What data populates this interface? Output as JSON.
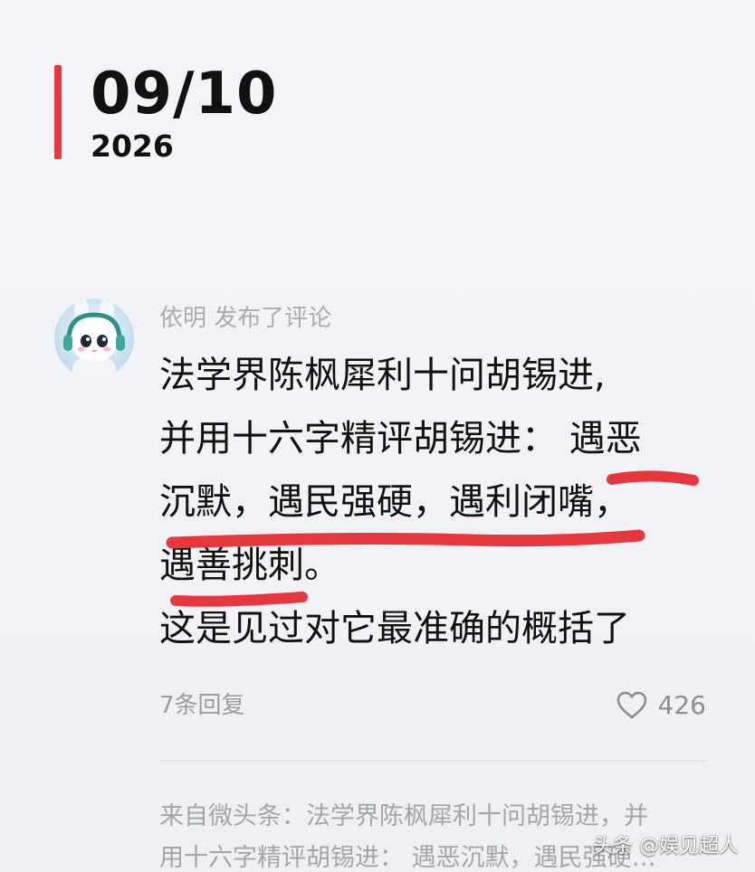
{
  "date": {
    "day_month": "09/10",
    "year": "2026",
    "accent_color": "#e8383d"
  },
  "comment": {
    "author_line": "依明 发布了评论",
    "avatar_icon": "cartoon-bunny-with-headphones",
    "lines": [
      "法学界陈枫犀利十问胡锡进,",
      "并用十六字精评胡锡进： 遇恶",
      "沉默，遇民强硬，遇利闭嘴，",
      "遇善挑刺。",
      "这是见过对它最准确的概括了"
    ],
    "highlight_color": "#e5373d",
    "reply_count": "7条回复",
    "like_icon": "heart-outline-icon",
    "like_count": "426"
  },
  "source": {
    "lines": [
      "来自微头条：法学界陈枫犀利十问胡锡进，并",
      "用十六字精评胡锡进： 遇恶沉默，遇民强硬…"
    ]
  },
  "watermark": "头条 @娱见超人"
}
